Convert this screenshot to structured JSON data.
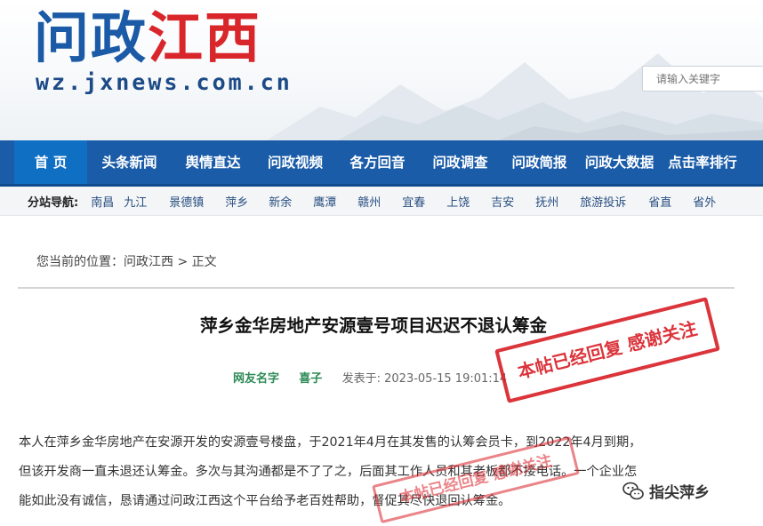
{
  "header": {
    "logo_blue": "问政",
    "logo_red": "江西",
    "logo_url": "wz.jxnews.com.cn",
    "search_placeholder": "请输入关键字"
  },
  "nav": {
    "items": [
      "首 页",
      "头条新闻",
      "舆情直达",
      "问政视频",
      "各方回音",
      "问政调查",
      "问政简报",
      "问政大数据",
      "点击率排行"
    ]
  },
  "subnav": {
    "label": "分站导航:",
    "items": [
      "南昌",
      "九江",
      "景德镇",
      "萍乡",
      "新余",
      "鹰潭",
      "赣州",
      "宜春",
      "上饶",
      "吉安",
      "抚州",
      "旅游投诉",
      "省直",
      "省外"
    ]
  },
  "breadcrumb": {
    "prefix": "您当前的位置：",
    "home": "问政江西",
    "separator": " > ",
    "current": "正文"
  },
  "article": {
    "title": "萍乡金华房地产安源壹号项目迟迟不退认筹金",
    "author_label": "网友名字",
    "author": "喜子",
    "date_label": "发表于:",
    "date": "2023-05-15 19:01:14",
    "paragraph_lines": [
      "本人在萍乡金华房地产在安源开发的安源壹号楼盘，于2021年4月在其发售的认筹会员卡，到2022年4月到期，",
      "但该开发商一直未退还认筹金。多次与其沟通都是不了了之，后面其工作人员和其老板都不接电话。一个企业怎",
      "能如此没有诚信，恳请通过问政江西这个平台给予老百姓帮助，督促其尽快退回认筹金。"
    ]
  },
  "stamps": {
    "big": "本帖已经回复 感谢关注",
    "small": "本帖已经回复 感谢关注"
  },
  "watermark": {
    "text": "指尖萍乡",
    "icon": "wechat-icon"
  },
  "colors": {
    "nav_bg": "#1b5ca8",
    "nav_active": "#0f6fc3",
    "logo_red": "#d8262b",
    "logo_blue": "#1b5aa6",
    "stamp_red": "#d81f26",
    "author_green": "#2e8b57"
  }
}
